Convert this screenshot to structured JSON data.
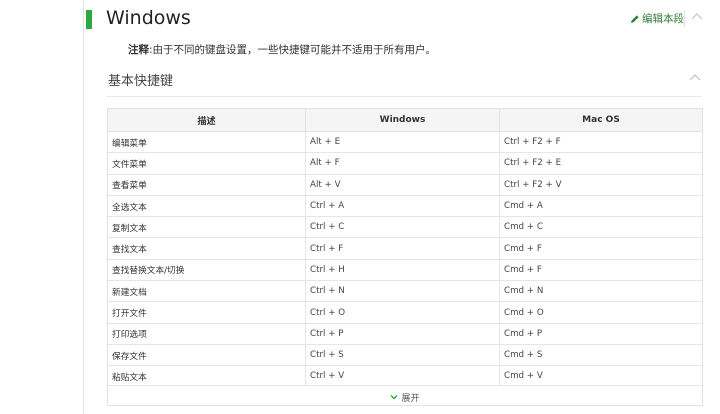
{
  "section": {
    "title": "Windows",
    "edit_label": "编辑本段"
  },
  "note": {
    "prefix": "注释",
    "text": ":由于不同的键盘设置，一些快捷键可能并不适用于所有用户。"
  },
  "subsection": {
    "title": "基本快捷键"
  },
  "table": {
    "headers": [
      "描述",
      "Windows",
      "Mac OS"
    ],
    "rows": [
      [
        "编辑菜单",
        "Alt + E",
        "Ctrl + F2 + F"
      ],
      [
        "文件菜单",
        "Alt + F",
        "Ctrl + F2 + E"
      ],
      [
        "查看菜单",
        "Alt + V",
        "Ctrl + F2 + V"
      ],
      [
        "全选文本",
        "Ctrl + A",
        "Cmd + A"
      ],
      [
        "复制文本",
        "Ctrl + C",
        "Cmd + C"
      ],
      [
        "查找文本",
        "Ctrl + F",
        "Cmd + F"
      ],
      [
        "查找替换文本/切换",
        "Ctrl + H",
        "Cmd + F"
      ],
      [
        "新建文档",
        "Ctrl + N",
        "Cmd + N"
      ],
      [
        "打开文件",
        "Ctrl + O",
        "Cmd + O"
      ],
      [
        "打印选项",
        "Ctrl + P",
        "Cmd + P"
      ],
      [
        "保存文件",
        "Ctrl + S",
        "Cmd + S"
      ],
      [
        "粘贴文本",
        "Ctrl + V",
        "Cmd + V"
      ]
    ],
    "expand_label": "展开"
  },
  "colors": {
    "accent_green": "#2daa3b",
    "link_green": "#2e7d32",
    "header_bg": "#f5f5f5",
    "border": "#e2e2e2"
  },
  "icons": {
    "edit": "pencil-icon",
    "collapse": "chevron-up-icon",
    "expand": "chevron-down-icon"
  }
}
